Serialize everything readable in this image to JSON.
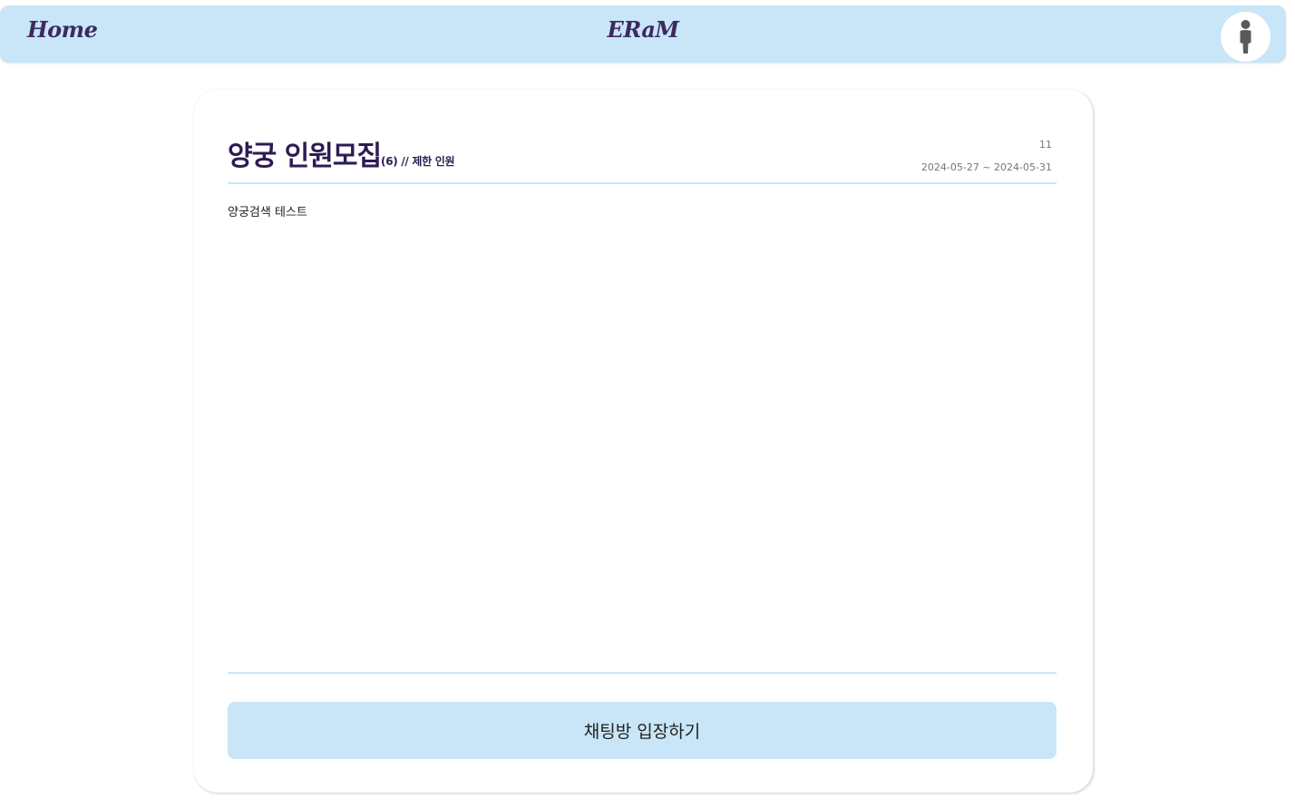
{
  "navbar": {
    "home_label": "Home",
    "brand": "ERaM",
    "avatar_icon": "person-icon",
    "background_color": "#c8e6f7",
    "text_color": "#3d2a5e"
  },
  "post": {
    "title": "양궁 인원모집",
    "limit_count": "(6)",
    "limit_label": " // 제한 인원",
    "views": "11",
    "period": "2024-05-27 ~ 2024-05-31",
    "content": "양궁검색 테스트"
  },
  "actions": {
    "enter_chat_label": "채팅방 입장하기"
  },
  "colors": {
    "accent": "#c8e6f7",
    "title": "#2e1b54",
    "muted": "#777777"
  }
}
